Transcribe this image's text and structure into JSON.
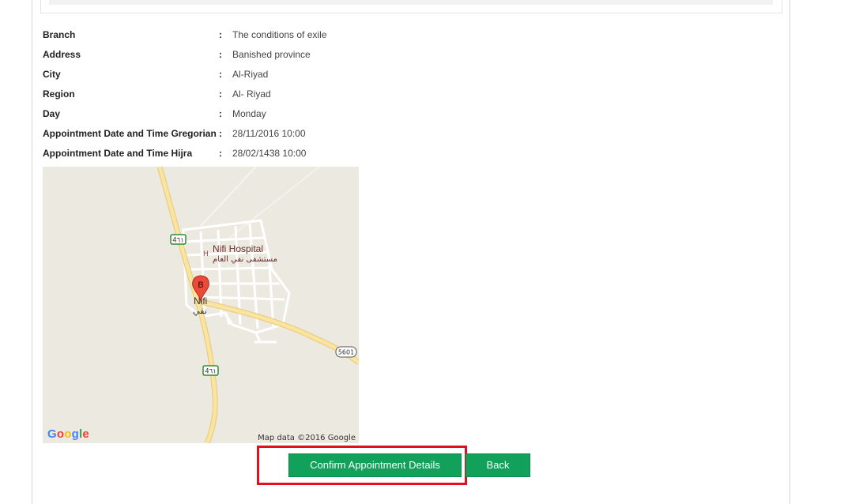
{
  "details": [
    {
      "label": "Branch",
      "value": "The conditions of exile"
    },
    {
      "label": "Address",
      "value": "Banished province"
    },
    {
      "label": "City",
      "value": "Al-Riyad"
    },
    {
      "label": "Region",
      "value": "Al- Riyad"
    },
    {
      "label": "Day",
      "value": "Monday"
    },
    {
      "label": "Appointment Date and Time Gregorian",
      "value": "28/11/2016 10:00"
    },
    {
      "label": "Appointment Date and Time Hijra",
      "value": "28/02/1438 10:00"
    }
  ],
  "separator": ":",
  "map": {
    "place_label": "Nifi Hospital",
    "place_label_ar": "مستشفى نفي العام",
    "town_label": "Nifi",
    "town_label_ar": "نفي",
    "marker_letter": "B",
    "hospital_symbol": "H",
    "road_shield_1": "4٦١",
    "road_shield_2": "4٦١",
    "road_shield_3": "5601",
    "attribution": "Map data ©2016 Google",
    "logo_letters": [
      "G",
      "o",
      "o",
      "g",
      "l",
      "e"
    ],
    "logo_colors": [
      "#4285f4",
      "#ea4335",
      "#fbbc05",
      "#4285f4",
      "#34a853",
      "#ea4335"
    ]
  },
  "buttons": {
    "confirm": "Confirm Appointment Details",
    "back": "Back"
  },
  "colors": {
    "button_green": "#12a15a",
    "highlight_red": "#e0101e"
  }
}
